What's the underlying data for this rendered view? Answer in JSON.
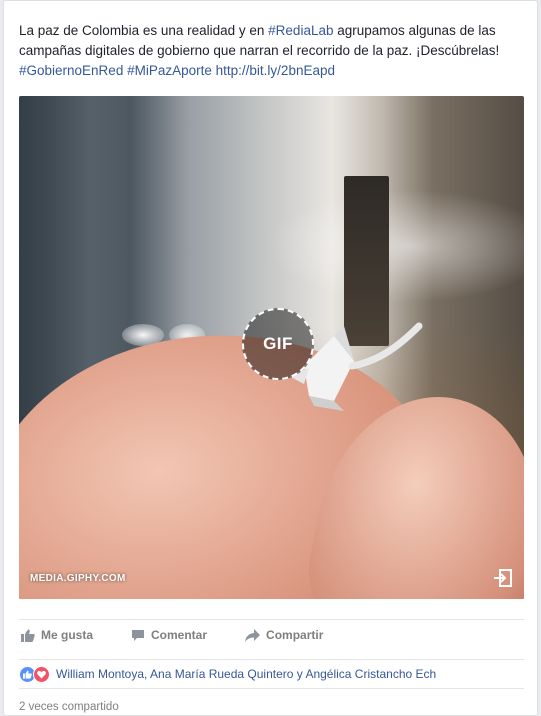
{
  "post": {
    "text_parts": {
      "p1": "La paz de Colombia es una realidad y en ",
      "tag1": "#RediaLab",
      "p2": " agrupamos algunas de las campañas digitales de gobierno que narran el recorrido de la paz. ¡Descúbrelas! ",
      "tag2": "#GobiernoEnRed",
      "p3": " ",
      "tag3": "#MiPazAporte",
      "p4": " ",
      "link": "http://bit.ly/2bnEapd"
    }
  },
  "media": {
    "badge": "GIF",
    "source": "MEDIA.GIPHY.COM",
    "icon": "open-external-icon"
  },
  "actions": {
    "like": "Me gusta",
    "comment": "Comentar",
    "share": "Compartir"
  },
  "reactions": {
    "icons": [
      "like-reaction-icon",
      "love-reaction-icon"
    ],
    "names": "William Montoya, Ana María Rueda Quintero y Angélica Cristancho Ech"
  },
  "shares": {
    "text": "2 veces compartido"
  },
  "colors": {
    "link": "#365899",
    "like": "#5890ff",
    "love": "#f25268",
    "muted": "#7f7f7f"
  }
}
